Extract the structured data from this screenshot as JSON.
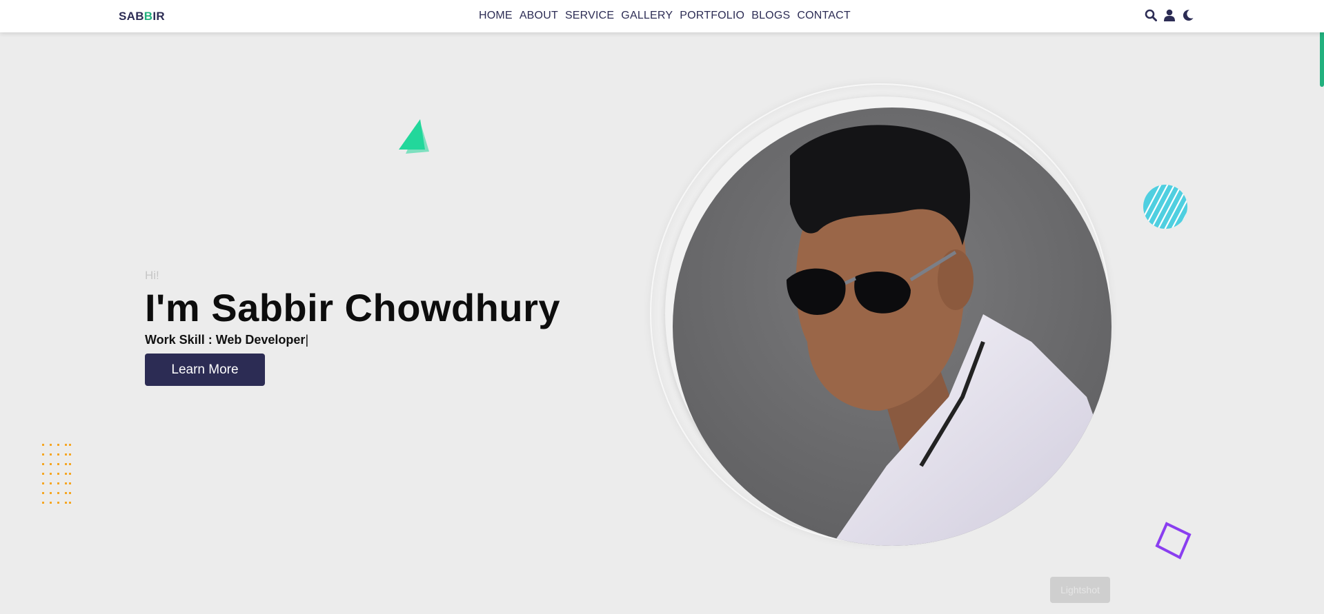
{
  "brand": {
    "prefix": "SAB",
    "highlight": "B",
    "suffix": "IR"
  },
  "nav": {
    "items": [
      "HOME",
      "ABOUT",
      "SERVICE",
      "GALLERY",
      "PORTFOLIO",
      "BLOGS",
      "CONTACT"
    ],
    "icons": [
      "search-icon",
      "user-icon",
      "moon-icon"
    ]
  },
  "hero": {
    "greeting": "Hi!",
    "headline": "I'm Sabbir Chowdhury",
    "skill_label": "Work Skill :",
    "skill_value": "Web Developer",
    "cursor": "|",
    "button_label": "Learn More",
    "photo_alt": "Portrait photo of Sabbir Chowdhury"
  },
  "overlay": {
    "label": "Lightshot"
  },
  "colors": {
    "primary": "#2c2c54",
    "accent_green": "#22b07d",
    "background": "#ececec",
    "triangle": "#22d79b",
    "cyan_circle": "#4fcfe0",
    "dots": "#f5a623",
    "diamond": "#8a3ef0"
  }
}
